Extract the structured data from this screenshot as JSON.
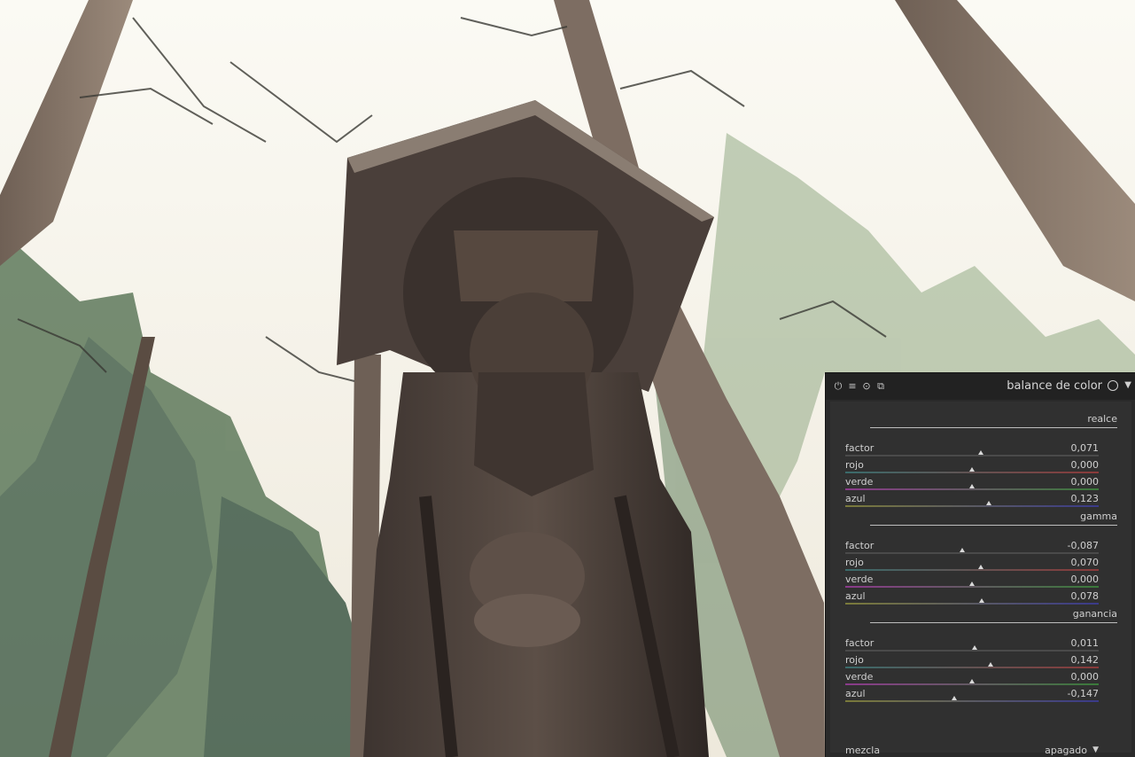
{
  "module": {
    "title": "balance de color",
    "header_icons": [
      "power-icon",
      "menu-icon",
      "reset-icon",
      "duplicate-icon"
    ],
    "preset_icon": "circle-icon",
    "expand_icon": "triangle-down-icon"
  },
  "sections": [
    {
      "title": "realce",
      "rows": [
        {
          "label": "factor",
          "value": "0,071",
          "position": 0.535
        },
        {
          "label": "rojo",
          "value": "0,000",
          "position": 0.5
        },
        {
          "label": "verde",
          "value": "0,000",
          "position": 0.5
        },
        {
          "label": "azul",
          "value": "0,123",
          "position": 0.565
        }
      ]
    },
    {
      "title": "gamma",
      "rows": [
        {
          "label": "factor",
          "value": "-0,087",
          "position": 0.46
        },
        {
          "label": "rojo",
          "value": "0,070",
          "position": 0.535
        },
        {
          "label": "verde",
          "value": "0,000",
          "position": 0.5
        },
        {
          "label": "azul",
          "value": "0,078",
          "position": 0.54
        }
      ]
    },
    {
      "title": "ganancia",
      "rows": [
        {
          "label": "factor",
          "value": "0,011",
          "position": 0.51
        },
        {
          "label": "rojo",
          "value": "0,142",
          "position": 0.575
        },
        {
          "label": "verde",
          "value": "0,000",
          "position": 0.5
        },
        {
          "label": "azul",
          "value": "-0,147",
          "position": 0.43
        }
      ]
    }
  ],
  "blend": {
    "label": "mezcla",
    "value": "apagado"
  },
  "colors": {
    "panel_bg": "#303030",
    "header_bg": "#222222",
    "text": "#cfcfcf",
    "slider_factor": "#4a4a4a",
    "slider_rojo": "#5a3a3a",
    "slider_verde": "#3a5a3a",
    "slider_azul": "#3a3a5a"
  }
}
